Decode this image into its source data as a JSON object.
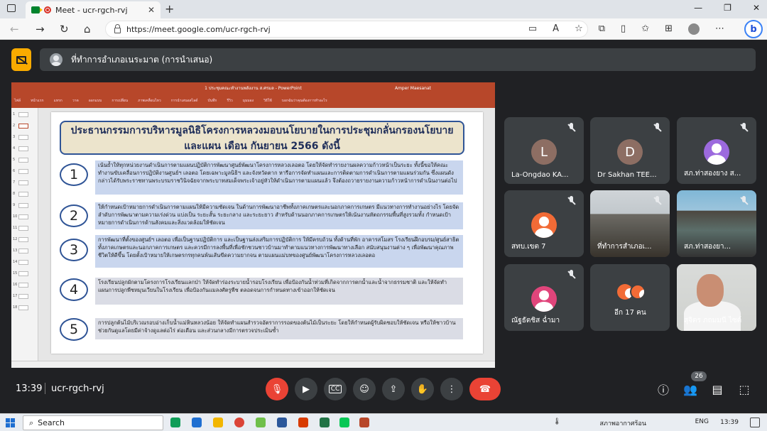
{
  "browser": {
    "tab_title": "Meet - ucr-rgch-rvj",
    "tab_close": "✕",
    "new_tab": "+",
    "url": "https://meet.google.com/ucr-rgch-rvj",
    "window_controls": [
      "—",
      "❐",
      "✕"
    ],
    "bing_label": "b"
  },
  "meet": {
    "presenter_label": "ที่ทำการอำเภอเนระมาต (การนำเสนอ)",
    "time": "13:39",
    "meeting_code": "ucr-rgch-rvj",
    "participant_count": "26",
    "tiles": [
      {
        "name": "La-Ongdao KA...",
        "initial": "L",
        "color": "#8d6e63"
      },
      {
        "name": "Dr Sakhan TEE...",
        "initial": "D",
        "color": "#8d6e63"
      },
      {
        "name": "สภ.ท่าสองยาง ส...",
        "initial": "",
        "color": "#9c6ade"
      },
      {
        "name": "สทบ.เขต 7",
        "initial": "",
        "color": "#f26b36"
      },
      {
        "name": "ที่ทำการสำเภอเ...",
        "initial": "",
        "color": ""
      },
      {
        "name": "สภ.ท่าสองยา...",
        "initial": "",
        "color": ""
      },
      {
        "name": "ณัฐธัตชิส ฉ่ำมา",
        "initial": "",
        "color": "#e0457b"
      },
      {
        "name": "อีก 17 คน",
        "initial": "",
        "color": "#f26b36"
      },
      {
        "name": "สุจิตร ภถมมนี ไซต์",
        "initial": "",
        "color": ""
      }
    ]
  },
  "slide": {
    "ppt_title": "1 ประชุมคณะทำงานพลังงาน ส.ศรมล - PowerPoint",
    "ppt_user": "Amper Maesanat",
    "ribbon": [
      "ไฟล์",
      "หน้าแรก",
      "แทรก",
      "วาด",
      "ออกแบบ",
      "การเปลี่ยน",
      "ภาพเคลื่อนไหว",
      "การนำเสนอสไลด์",
      "บันทึก",
      "รีวิว",
      "มุมมอง",
      "วิธีใช้",
      "บอกฉันว่าคุณต้องการทำอะไร"
    ],
    "title": "ประธานกรรมการบริหารมูลนิธิโครงการหลวงมอบนโยบายในการประชุมกลั่นกรองนโยบายและแผน เดือน กันยายน 2566 ดังนี้",
    "items": [
      {
        "num": "1",
        "text": "เน้นย้ำให้ทุกหน่วยงานดำเนินการตามแผนปฏิบัติการพัฒนาศูนย์พัฒนาโครงการหลวงเลอตอ โดยให้จัดทำรายงานผลความก้าวหน้าเป็นระยะ ทั้งนี้ขอให้คณะทำงานขับเคลื่อนการปฏิบัติงานศูนย์ฯ เลอตอ โดยเฉพาะมูลนิธิฯ และจังหวัดตาก หารือการจัดทำแผนและการติดตามการดำเนินการตามแผนร่วมกัน ซึ่งแผนดังกล่าวได้รับพระราชทานพระบรมราชวินิจฉัยจากพระบาทสมเด็จพระเจ้าอยู่หัวให้ดำเนินการตามแผนแล้ว จึงต้องถวายรายงานความก้าวหน้าการดำเนินงานต่อไป"
      },
      {
        "num": "2",
        "text": "ให้กำหนดเป้าหมายการดำเนินการตามแผนให้มีความชัดเจน ในด้านการพัฒนาอาชีพทั้งภาคเกษตรและนอกภาคการเกษตร มีแนวทางการทำงานอย่างไร โดยจัดลำดับการพัฒนาตามความเร่งด่วน แบ่งเป็น ระยะสั้น ระยะกลาง และระยะยาว สำหรับด้านนอกภาคการเกษตรให้เน้นงานหัตถกรรมพื้นที่สูงรวมทั้ง กำหนดเป้าหมายการดำเนินการด้านสังคมและสิ่งแวดล้อมให้ชัดเจน"
      },
      {
        "num": "3",
        "text": "การพัฒนาที่ตั้งของศูนย์ฯ เลอตอ เพื่อเป็นฐานปฏิบัติการ และเป็นฐานส่งเสริมการปฏิบัติการ ให้มีครบถ้วน ทั้งด้านที่พัก อาคารสโมสร โรงเรียนฝึกอบรม/ศูนย์สาธิต ทั้งภาคเกษตรและนอกภาคการเกษตร และควรมีการลงพื้นที่เพื่อชักชวนชาวบ้านมาทำตามแนวทางการพัฒนาทางเลือก สนับสนุนงานต่าง ๆ เพื่อพัฒนาคุณภาพชีวิตให้ดีขึ้น โดยตั้งเป้าหมายให้เกษตรกรทุกคนพ้นเส้นขีดความยากจน ตามแผนแม่บทของศูนย์พัฒนาโครงการหลวงเลอตอ"
      },
      {
        "num": "4",
        "text": "โรงเรียนปลูกผักตามโครงการโรงเรียนแลกป่า ให้จัดทำร่องระบายน้ำรอบโรงเรียน เพื่อป้องกันน้ำท่วมที่เกิดจากการตกน้ำและน้ำจากธรรมชาติ และให้จัดทำแผนการปลูกพืชหมุนเวียนในโรงเรียน เพื่อป้องกันแมลงศัตรูพืช ตลอดจนการกำหนดทางเข้าออกให้ชัดเจน"
      },
      {
        "num": "5",
        "text": "การปลูกต้นไม้บริเวณรอบอ่างเก็บน้ำแม่หินหลวงน้อย ให้จัดทำแผนสำรวจอัตราการรอดของต้นไม้เป็นระยะ โดยให้กำหนดผู้รับผิดชอบให้ชัดเจน หรือให้ชาวบ้านช่วยกันดูแลโดยมีค่าจ้างดูแลต่อไร่ ต่อเดือน และส่วนกลางมีการตรวจประเมินซ้ำ"
      }
    ]
  },
  "taskbar": {
    "search_label": "Search",
    "weather": "สภาพอากาศร้อน",
    "lang": "ENG",
    "clock": "13:39"
  }
}
